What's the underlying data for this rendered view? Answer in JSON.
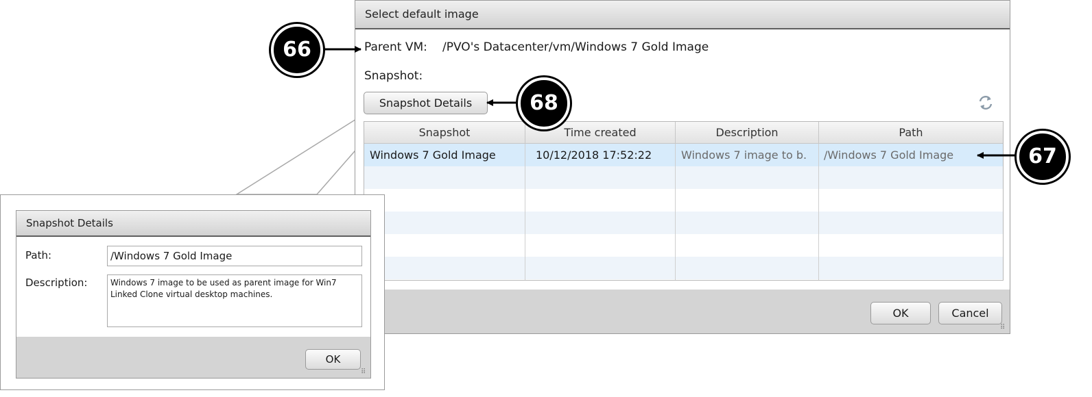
{
  "main_dialog": {
    "title": "Select default image",
    "parent_vm_label": "Parent VM:",
    "parent_vm_value": "/PVO's Datacenter/vm/Windows 7 Gold Image",
    "snapshot_label": "Snapshot:",
    "snapshot_details_button": "Snapshot Details",
    "refresh_icon": "refresh-icon",
    "table": {
      "columns": [
        "Snapshot",
        "Time created",
        "Description",
        "Path"
      ],
      "rows": [
        {
          "snapshot": "Windows 7 Gold Image",
          "time_created": "10/12/2018 17:52:22",
          "description": "Windows 7 image to b.",
          "path": "/Windows 7 Gold Image",
          "selected": true
        }
      ]
    },
    "ok_button": "OK",
    "cancel_button": "Cancel"
  },
  "snapshot_details": {
    "title": "Snapshot Details",
    "path_label": "Path:",
    "path_value": "/Windows 7 Gold Image",
    "description_label": "Description:",
    "description_value": "Windows 7 image to be used as parent image for Win7 Linked Clone virtual desktop machines.",
    "ok_button": "OK"
  },
  "callouts": [
    "66",
    "67",
    "68"
  ],
  "colors": {
    "selected_row": "#d7ebfb",
    "alt_row": "#eef4fa",
    "title_bar_border": "#5e5e5e",
    "footer_bg": "#d4d4d4",
    "callout_bg": "#000000"
  }
}
